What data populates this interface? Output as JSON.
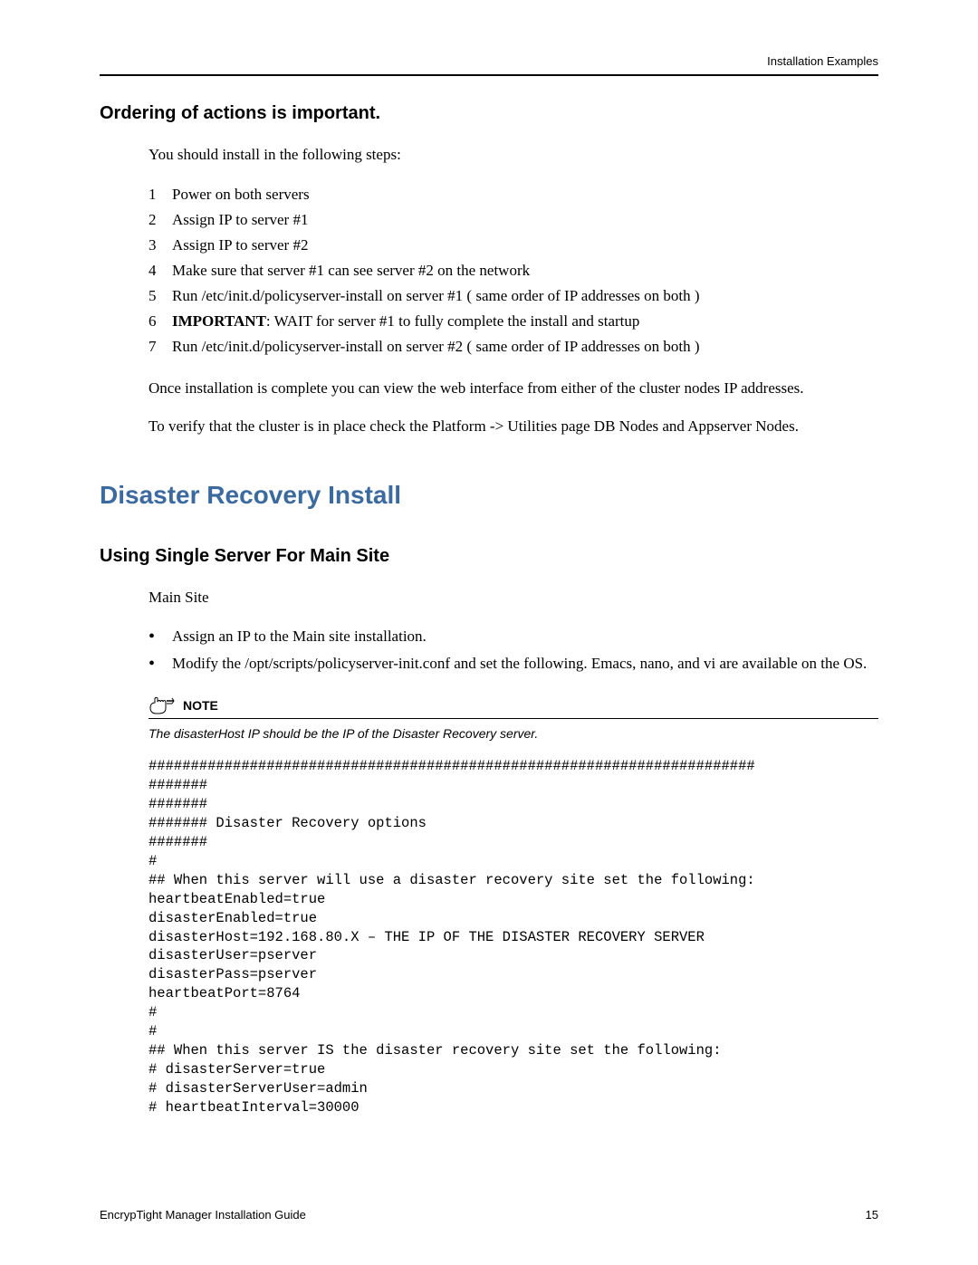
{
  "header": {
    "right_text": "Installation Examples"
  },
  "section1": {
    "title": "Ordering of actions is important.",
    "intro": "You should install in the following steps:",
    "steps": [
      {
        "n": "1",
        "text": "Power on both servers"
      },
      {
        "n": "2",
        "text": "Assign IP to server #1"
      },
      {
        "n": "3",
        "text": "Assign IP to server #2"
      },
      {
        "n": "4",
        "text": "Make sure that server #1 can see server #2 on the network"
      },
      {
        "n": "5",
        "text": "Run /etc/init.d/policyserver-install on server #1 ( same order of IP addresses on both )"
      },
      {
        "n": "6",
        "bold_prefix": "IMPORTANT",
        "text": ": WAIT for server #1 to fully complete the install and startup"
      },
      {
        "n": "7",
        "text": "Run /etc/init.d/policyserver-install on server #2 ( same order of IP addresses on both )"
      }
    ],
    "para1": "Once installation is complete you can view the web interface from either of the cluster nodes IP addresses.",
    "para2": "To verify that the cluster is in place check the Platform -> Utilities page DB Nodes and Appserver Nodes."
  },
  "section2": {
    "title": "Disaster Recovery Install",
    "subtitle": "Using Single Server For Main Site",
    "intro": "Main Site",
    "bullets": [
      "Assign an IP to the Main site installation.",
      "Modify the /opt/scripts/policyserver-init.conf and set the following. Emacs, nano, and vi are available on the OS."
    ],
    "note_label": "NOTE",
    "note_text": "The disasterHost IP should be the IP of the Disaster Recovery server.",
    "code": "########################################################################\n#######\n#######\n####### Disaster Recovery options\n#######\n#\n## When this server will use a disaster recovery site set the following:\nheartbeatEnabled=true\ndisasterEnabled=true\ndisasterHost=192.168.80.X – THE IP OF THE DISASTER RECOVERY SERVER\ndisasterUser=pserver\ndisasterPass=pserver\nheartbeatPort=8764\n#\n#\n## When this server IS the disaster recovery site set the following:\n# disasterServer=true\n# disasterServerUser=admin\n# heartbeatInterval=30000"
  },
  "footer": {
    "left": "EncrypTight Manager Installation Guide",
    "right": "15"
  }
}
